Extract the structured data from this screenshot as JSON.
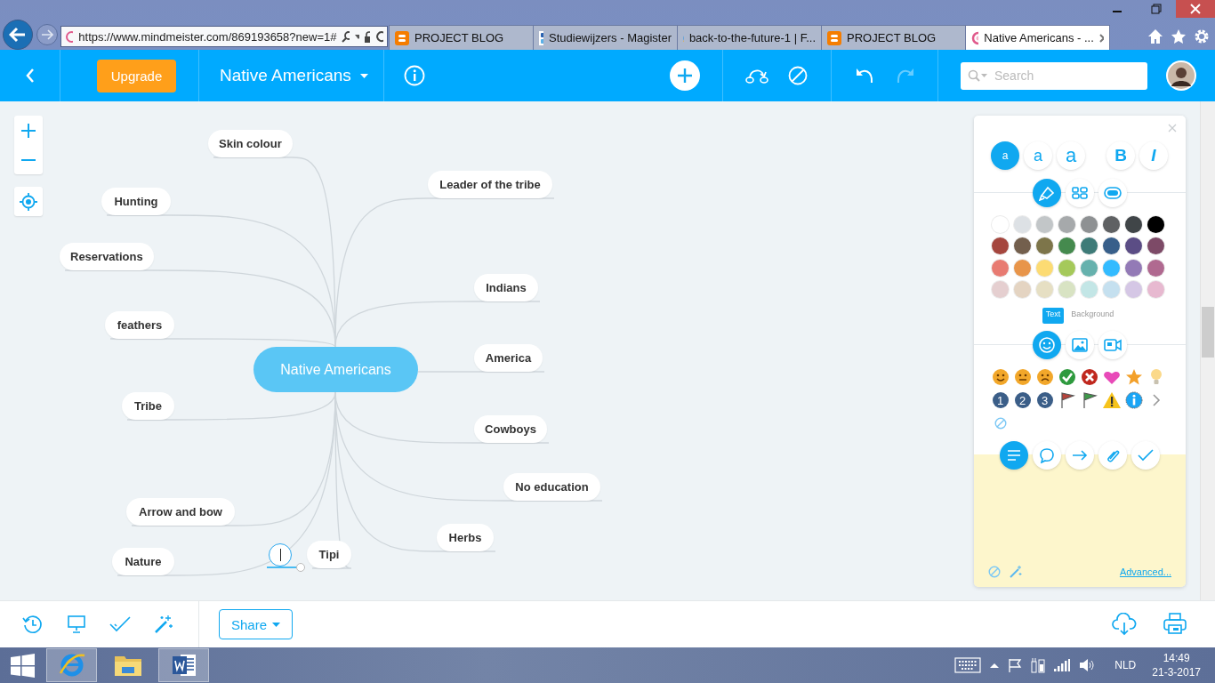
{
  "browser": {
    "address": "https://www.mindmeister.com/869193658?new=1#",
    "tabs": [
      {
        "label": "PROJECT BLOG",
        "kind": "blog",
        "selected": false
      },
      {
        "label": "Studiewijzers - Magister",
        "kind": "magister",
        "selected": false
      },
      {
        "label": "back-to-the-future-1 | F...",
        "kind": "ie",
        "selected": false
      },
      {
        "label": "PROJECT BLOG",
        "kind": "blog",
        "selected": false
      },
      {
        "label": "Native Americans - ...",
        "kind": "mindmeister",
        "selected": true
      }
    ]
  },
  "toolbar": {
    "upgrade": "Upgrade",
    "map_title": "Native Americans",
    "search_placeholder": "Search",
    "undo": {
      "disabled": false
    },
    "redo": {
      "disabled": true
    }
  },
  "mind_map": {
    "center": "Native Americans",
    "topics": [
      {
        "label": "Skin colour"
      },
      {
        "label": "Hunting"
      },
      {
        "label": "Reservations"
      },
      {
        "label": "feathers"
      },
      {
        "label": "Tribe"
      },
      {
        "label": "Arrow and bow"
      },
      {
        "label": "Nature"
      },
      {
        "label": "Tipi"
      },
      {
        "label": "Leader of the tribe"
      },
      {
        "label": "Indians"
      },
      {
        "label": "America"
      },
      {
        "label": "Cowboys"
      },
      {
        "label": "No education"
      },
      {
        "label": "Herbs"
      }
    ],
    "new_topic": {
      "editing": true
    }
  },
  "format_panel": {
    "font_sizes": [
      {
        "label": "a",
        "selected": true
      },
      {
        "label": "a",
        "selected": false
      },
      {
        "label": "a",
        "selected": false
      }
    ],
    "bold": "B",
    "italic": "I",
    "style_tabs": [
      {
        "kind": "paint",
        "selected": true
      },
      {
        "kind": "layout",
        "selected": false
      },
      {
        "kind": "shape",
        "selected": false
      }
    ],
    "colors": [
      {
        "color": "#ffffff"
      },
      {
        "color": "#dde1e5"
      },
      {
        "color": "#c2c6c8"
      },
      {
        "color": "#a6a9ab"
      },
      {
        "color": "#8e9193"
      },
      {
        "color": "#5f6163"
      },
      {
        "color": "#404548"
      },
      {
        "color": "#000000"
      },
      {
        "color": "#a5463e"
      },
      {
        "color": "#735f4d"
      },
      {
        "color": "#7d754a"
      },
      {
        "color": "#458a4e"
      },
      {
        "color": "#3e7b78"
      },
      {
        "color": "#385f8a"
      },
      {
        "color": "#5b4d85"
      },
      {
        "color": "#7d4a67"
      },
      {
        "color": "#e87b72"
      },
      {
        "color": "#e8954a"
      },
      {
        "color": "#fcdb73"
      },
      {
        "color": "#a5c95a"
      },
      {
        "color": "#66b1ad"
      },
      {
        "color": "#33bbff"
      },
      {
        "color": "#937ab6"
      },
      {
        "color": "#b06990"
      },
      {
        "color": "#e5cfd0"
      },
      {
        "color": "#e4d4c2"
      },
      {
        "color": "#e6dfc3"
      },
      {
        "color": "#d8e3c3"
      },
      {
        "color": "#c3e6e6"
      },
      {
        "color": "#c5e0ef"
      },
      {
        "color": "#d5c7e5"
      },
      {
        "color": "#e7b9d0"
      }
    ],
    "color_targets": [
      {
        "label": "Text",
        "selected": true
      },
      {
        "label": "Background",
        "selected": false
      }
    ],
    "media_tabs": [
      {
        "kind": "emoji",
        "selected": true
      },
      {
        "kind": "image",
        "selected": false
      },
      {
        "kind": "video",
        "selected": false
      }
    ],
    "icons": [
      {
        "kind": "smile"
      },
      {
        "kind": "neutral"
      },
      {
        "kind": "sad"
      },
      {
        "kind": "check"
      },
      {
        "kind": "cross"
      },
      {
        "kind": "heart"
      },
      {
        "kind": "star"
      },
      {
        "kind": "bulb"
      },
      {
        "kind": "number",
        "label": "1"
      },
      {
        "kind": "number",
        "label": "2"
      },
      {
        "kind": "number",
        "label": "3"
      },
      {
        "kind": "flag",
        "color": "#b5443c"
      },
      {
        "kind": "flag",
        "color": "#3f9a4a"
      },
      {
        "kind": "warning"
      },
      {
        "kind": "info"
      },
      {
        "kind": "more"
      },
      {
        "kind": "none"
      }
    ],
    "note_tabs": [
      {
        "kind": "note",
        "selected": true
      },
      {
        "kind": "comment",
        "selected": false
      },
      {
        "kind": "link",
        "selected": false
      },
      {
        "kind": "attachment",
        "selected": false
      },
      {
        "kind": "task",
        "selected": false
      }
    ],
    "advanced": "Advanced..."
  },
  "bottom_bar": {
    "share": "Share"
  },
  "taskbar": {
    "language": "NLD",
    "time": "14:49",
    "date": "21-3-2017"
  }
}
